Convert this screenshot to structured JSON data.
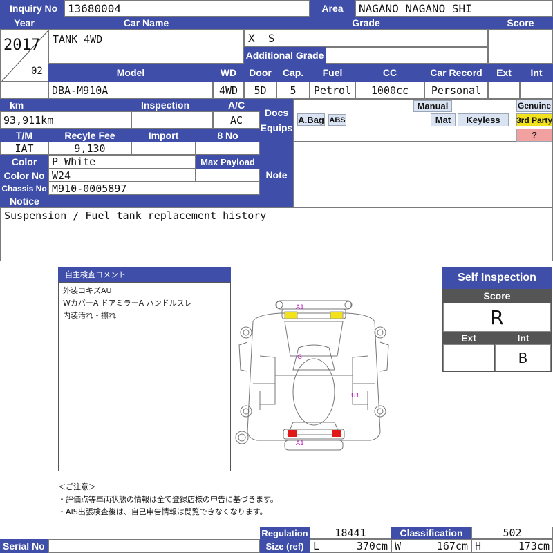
{
  "header": {
    "inquiry_no_label": "Inquiry No",
    "inquiry_no": "13680004",
    "area_label": "Area",
    "area": "NAGANO NAGANO SHI"
  },
  "car": {
    "year_label": "Year",
    "year": "2017",
    "month": "02",
    "car_name_label": "Car Name",
    "car_name": "TANK 4WD",
    "grade_label": "Grade",
    "grade": "X  S",
    "additional_grade_label": "Additional Grade",
    "additional_grade": "",
    "score_label": "Score",
    "score": ""
  },
  "specs": {
    "model_label": "Model",
    "model": "DBA-M910A",
    "wd_label": "WD",
    "wd": "4WD",
    "door_label": "Door",
    "door": "5D",
    "cap_label": "Cap.",
    "cap": "5",
    "fuel_label": "Fuel",
    "fuel": "Petrol",
    "cc_label": "CC",
    "cc": "1000cc",
    "car_record_label": "Car Record",
    "car_record": "Personal",
    "ext_label": "Ext",
    "ext": "",
    "int_label": "Int",
    "int": ""
  },
  "details": {
    "km_label": "km",
    "km": "93,911km",
    "inspection_label": "Inspection",
    "inspection": "",
    "ac_label": "A/C",
    "ac": "AC",
    "tm_label": "T/M",
    "tm": "IAT",
    "recycle_fee_label": "Recyle Fee",
    "recycle_fee": "9,130",
    "import_label": "Import",
    "import": "",
    "eight_no_label": "8 No",
    "eight_no": "",
    "color_label": "Color",
    "color": "P White",
    "max_payload_label": "Max Payload",
    "max_payload": "",
    "color_no_label": "Color No",
    "color_no": "W24",
    "chassis_no_label": "Chassis No",
    "chassis_no": "M910-0005897"
  },
  "docs": {
    "docs_label": "Docs",
    "equips_label": "Equips",
    "note_label": "Note",
    "equipment": {
      "abag": "A.Bag",
      "abs": "ABS",
      "manual": "Manual",
      "mat": "Mat",
      "keyless": "Keyless",
      "genuine": "Genuine",
      "third_party": "3rd Party",
      "question": "?"
    }
  },
  "notice": {
    "label": "Notice",
    "text": "Suspension / Fuel tank replacement history"
  },
  "inspection_comment": {
    "title": "自主検査コメント",
    "lines": [
      "外装コキズAU",
      "WカバーA  ドアミラーA  ハンドルスレ",
      "内装汚れ・擦れ"
    ]
  },
  "diagram_marks": {
    "front": "A1",
    "glass": "G",
    "side": "U1",
    "rear": "A1",
    "highlight_color": "#f2e11d",
    "rear_light_color": "#e01818",
    "mark_color": "#c21ac2"
  },
  "self_inspection": {
    "title": "Self Inspection",
    "score_label": "Score",
    "score": "R",
    "ext_label": "Ext",
    "ext": "",
    "int_label": "Int",
    "int": "B"
  },
  "caution": {
    "title": "＜ご注意＞",
    "lines": [
      "・評価点等車両状態の情報は全て登録店様の申告に基づきます。",
      "・AIS出張検査後は、自己申告情報は閲覧できなくなります。"
    ]
  },
  "footer": {
    "serial_no_label": "Serial No",
    "serial_no": "",
    "regulation_label": "Regulation",
    "regulation": "18441",
    "classification_label": "Classification",
    "classification": "502",
    "size_label": "Size (ref)",
    "l_label": "L",
    "l": "370cm",
    "w_label": "W",
    "w": "167cm",
    "h_label": "H",
    "h": "173cm"
  },
  "colors": {
    "header_blue": "#3f4fa9",
    "dark_gray": "#555555",
    "equip_blue": "#d9e3f2",
    "third_party_yellow": "#f2e11d",
    "question_pink": "#f2a1a1"
  }
}
